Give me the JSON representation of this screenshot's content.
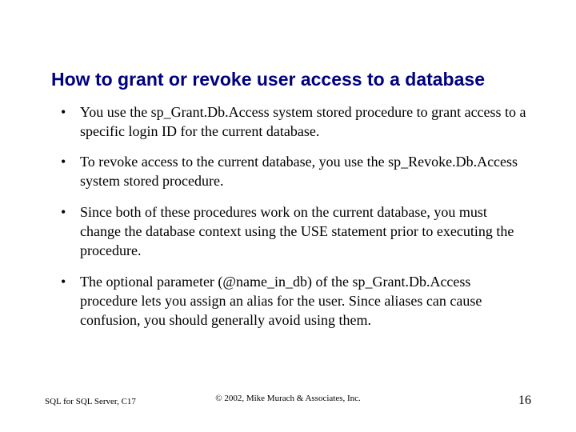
{
  "title": "How to grant or revoke user access to a database",
  "bullets": [
    "You use the sp_Grant.Db.Access system stored procedure to grant access to a specific login ID for the current database.",
    "To revoke access to the current database, you use the sp_Revoke.Db.Access system stored procedure.",
    "Since both of these procedures work on the current database, you must change the database context using the USE statement prior to executing the procedure.",
    "The optional parameter (@name_in_db) of the sp_Grant.Db.Access procedure lets you assign an alias for the user. Since aliases can cause confusion, you should generally avoid using them."
  ],
  "footer": {
    "left": "SQL for SQL Server, C17",
    "center": "© 2002, Mike Murach & Associates, Inc.",
    "right": "16"
  }
}
